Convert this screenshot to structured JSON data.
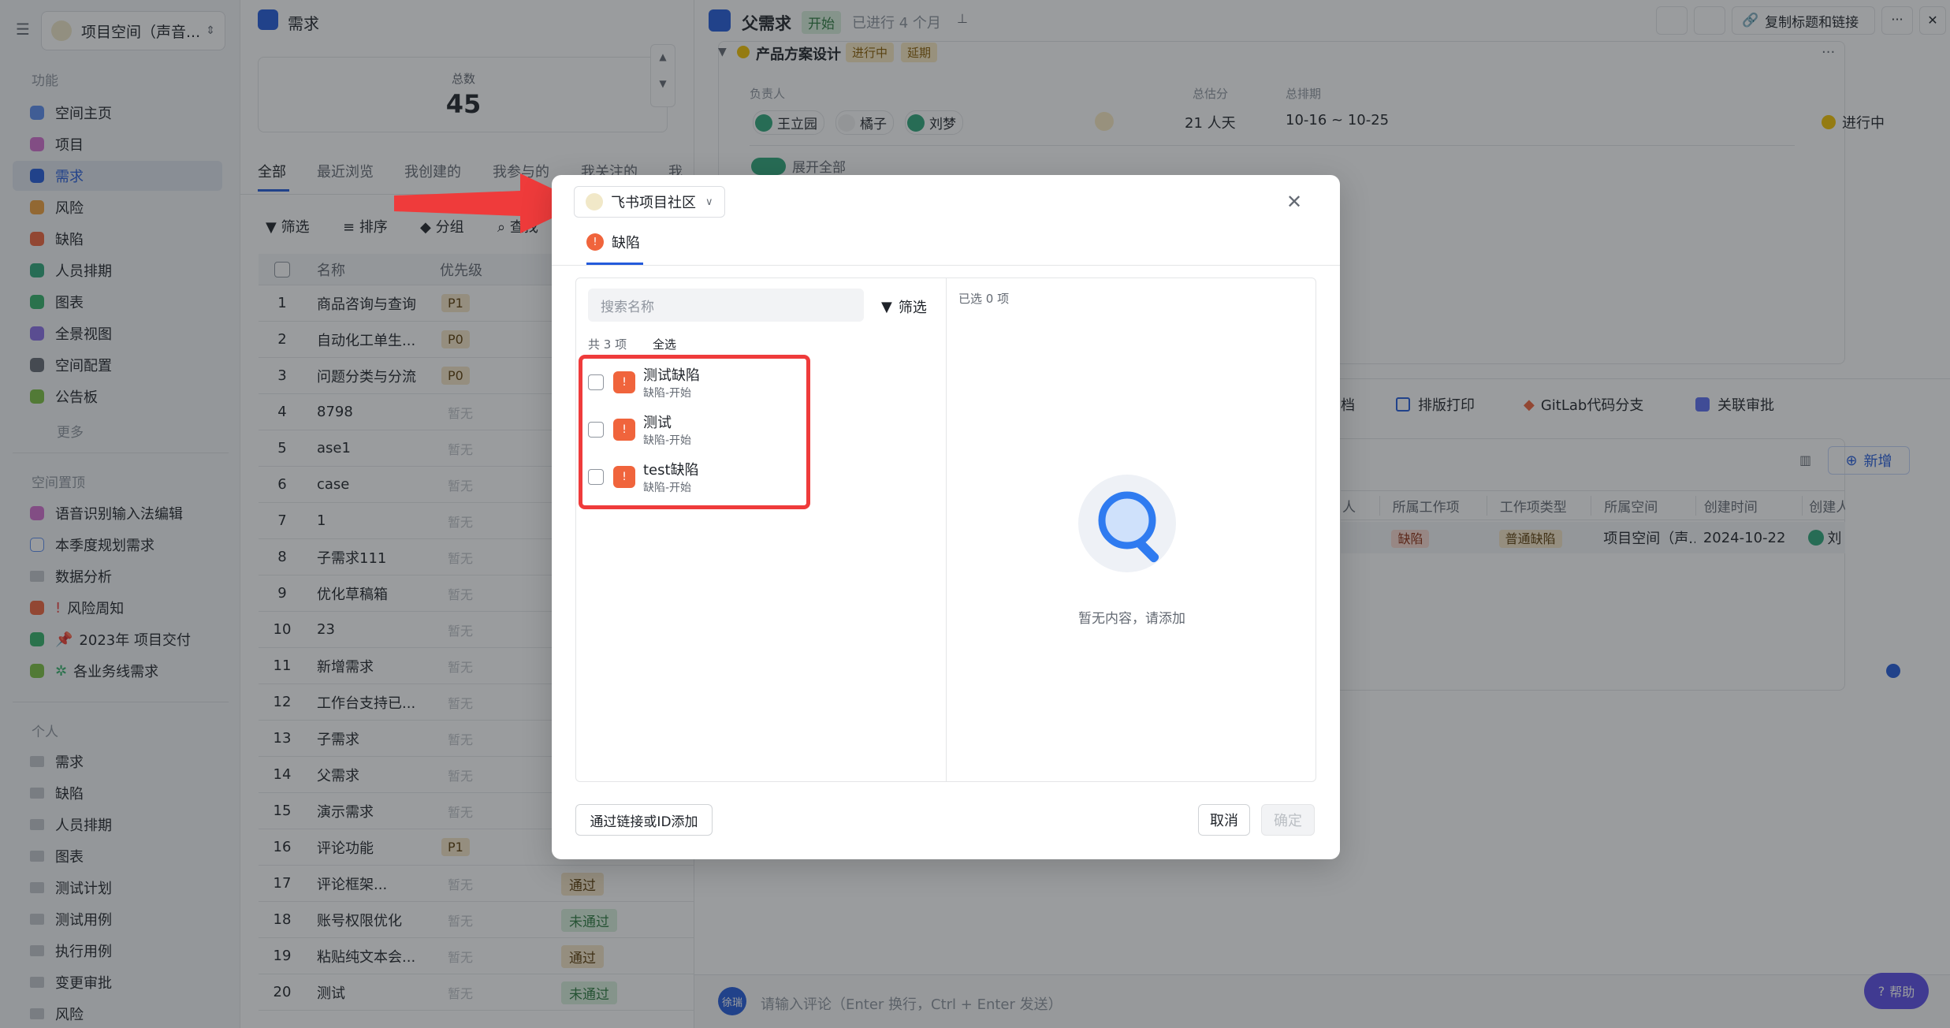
{
  "sidebar": {
    "space_name": "项目空间（声音...",
    "section_features": "功能",
    "features": [
      "空间主页",
      "项目",
      "需求",
      "风险",
      "缺陷",
      "人员排期",
      "图表",
      "全景视图",
      "空间配置",
      "公告板"
    ],
    "more": "更多",
    "section_pinned": "空间置顶",
    "pinned": [
      "语音识别输入法编辑",
      "本季度规划需求",
      "数据分析",
      "风险周知",
      "2023年 项目交付",
      "各业务线需求"
    ],
    "section_personal": "个人",
    "personal": [
      "需求",
      "缺陷",
      "人员排期",
      "图表",
      "测试计划",
      "测试用例",
      "执行用例",
      "变更审批",
      "风险"
    ]
  },
  "list": {
    "title": "需求",
    "total_label": "总数",
    "total_value": "45",
    "tabs": [
      "全部",
      "最近浏览",
      "我创建的",
      "我参与的",
      "我关注的",
      "我此"
    ],
    "toolbar": [
      "筛选",
      "排序",
      "分组",
      "查找"
    ],
    "col_name": "名称",
    "col_priority": "优先级",
    "rows": [
      {
        "n": "1",
        "name": "商品咨询与查询",
        "pri": "P1"
      },
      {
        "n": "2",
        "name": "自动化工单生...",
        "pri": "P0"
      },
      {
        "n": "3",
        "name": "问题分类与分流",
        "pri": "P0"
      },
      {
        "n": "4",
        "name": "8798",
        "pri": "暂无"
      },
      {
        "n": "5",
        "name": "ase1",
        "pri": "暂无"
      },
      {
        "n": "6",
        "name": "case",
        "pri": "暂无"
      },
      {
        "n": "7",
        "name": "1",
        "pri": "暂无"
      },
      {
        "n": "8",
        "name": "子需求111",
        "pri": "暂无"
      },
      {
        "n": "9",
        "name": "优化草稿箱",
        "pri": "暂无"
      },
      {
        "n": "10",
        "name": "23",
        "pri": "暂无"
      },
      {
        "n": "11",
        "name": "新增需求",
        "pri": "暂无"
      },
      {
        "n": "12",
        "name": "工作台支持已...",
        "pri": "暂无"
      },
      {
        "n": "13",
        "name": "子需求",
        "pri": "暂无"
      },
      {
        "n": "14",
        "name": "父需求",
        "pri": "暂无"
      },
      {
        "n": "15",
        "name": "演示需求",
        "pri": "暂无"
      },
      {
        "n": "16",
        "name": "评论功能",
        "pri": "P1"
      },
      {
        "n": "17",
        "name": "评论框架...",
        "pri": "暂无",
        "status": "通过"
      },
      {
        "n": "18",
        "name": "账号权限优化",
        "pri": "暂无",
        "status": "未通过"
      },
      {
        "n": "19",
        "name": "粘贴纯文本会...",
        "pri": "暂无",
        "status": "通过"
      },
      {
        "n": "20",
        "name": "测试",
        "pri": "暂无",
        "status": "未通过"
      }
    ]
  },
  "detail": {
    "title": "父需求",
    "status": "开始",
    "elapsed": "已进行 4 个月",
    "copy_btn": "复制标题和链接",
    "node_name": "产品方案设计",
    "node_tag1": "进行中",
    "node_tag2": "延期",
    "owner_label": "负责人",
    "points_label": "总估分",
    "schedule_label": "总排期",
    "owners": [
      "王立园",
      "橘子",
      "刘梦"
    ],
    "points": "21 人天",
    "schedule": "10-16 ~ 10-25",
    "progress_status": "进行中",
    "expand_all": "展开全部",
    "tabs": [
      "档",
      "排版打印",
      "GitLab代码分支",
      "关联审批"
    ],
    "add_btn": "新增",
    "cols": [
      "人",
      "所属工作项",
      "工作项类型",
      "所属空间",
      "创建时间",
      "创建人"
    ],
    "row": {
      "item": "缺陷",
      "type": "普通缺陷",
      "space": "项目空间（声...",
      "time": "2024-10-22",
      "creator": "刘"
    },
    "comment_placeholder": "请输入评论（Enter 换行，Ctrl + Enter 发送）",
    "comment_avatar": "徐瑞",
    "help": "帮助"
  },
  "modal": {
    "space_selector": "飞书项目社区",
    "tab": "缺陷",
    "search_placeholder": "搜索名称",
    "filter": "筛选",
    "count": "共 3 项",
    "select_all": "全选",
    "selected": "已选 0 项",
    "items": [
      {
        "name": "测试缺陷",
        "sub": "缺陷-开始"
      },
      {
        "name": "测试",
        "sub": "缺陷-开始"
      },
      {
        "name": "test缺陷",
        "sub": "缺陷-开始"
      }
    ],
    "empty_text": "暂无内容，请添加",
    "add_by_link": "通过链接或ID添加",
    "cancel": "取消",
    "confirm": "确定"
  },
  "colors": {
    "accent": "#245bdb",
    "highlight_red": "#ef3b3b",
    "defect": "#f0643c"
  }
}
